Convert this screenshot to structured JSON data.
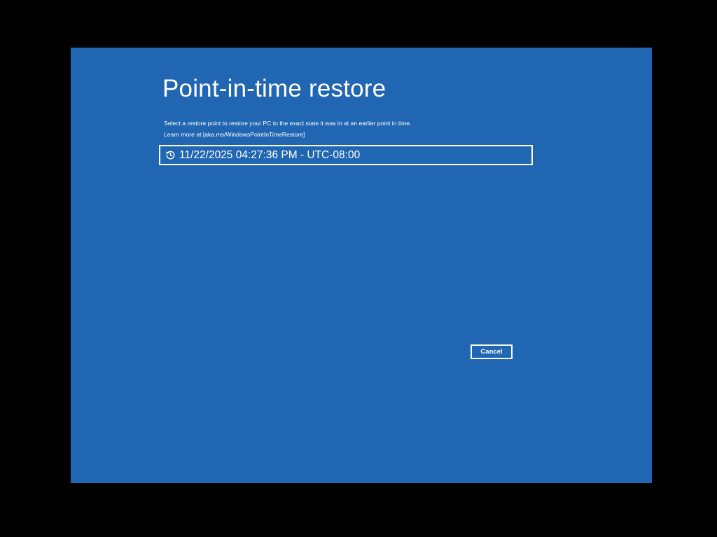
{
  "page": {
    "title": "Point-in-time restore",
    "description_line1": "Select a restore point to restore your PC to the exact state it was in at an earlier point in time.",
    "description_line2": "Learn more at [aka.ms/WindowsPointInTimeRestore]"
  },
  "restore_points": [
    {
      "icon": "history-icon",
      "label": "11/22/2025 04:27:36 PM - UTC-08:00"
    }
  ],
  "buttons": {
    "cancel_label": "Cancel"
  },
  "colors": {
    "background": "#2166b3",
    "outer": "#000000",
    "text": "#ffffff"
  }
}
